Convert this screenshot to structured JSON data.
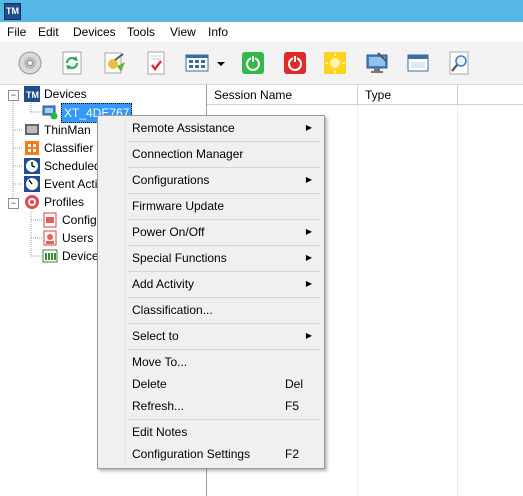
{
  "app": {
    "icon_text": "TM"
  },
  "menu": [
    "File",
    "Edit",
    "Devices",
    "Tools",
    "View",
    "Info"
  ],
  "toolbar": {
    "buttons": [
      "cd-icon",
      "refresh-icon",
      "wizard-icon",
      "checklist-icon",
      "grid-view-icon",
      "dropdown-arrow-icon",
      "power-on-icon",
      "power-off-icon",
      "sun-icon",
      "remote-desktop-icon",
      "window-icon",
      "search-icon"
    ]
  },
  "tree": {
    "devices": "Devices",
    "device_selected": "XT_4DE767",
    "thinman": "ThinMan",
    "classifier": "Classifier",
    "scheduled": "Scheduled",
    "event": "Event Acti",
    "profiles": "Profiles",
    "config": "Config",
    "users": "Users I",
    "device_profile": "Device"
  },
  "table": {
    "columns": [
      "Session Name",
      "Type"
    ]
  },
  "context_menu": [
    {
      "label": "Remote Assistance",
      "submenu": true
    },
    {
      "label": "Connection Manager"
    },
    {
      "label": "Configurations",
      "submenu": true
    },
    {
      "label": "Firmware Update"
    },
    {
      "label": "Power On/Off",
      "submenu": true
    },
    {
      "label": "Special Functions",
      "submenu": true
    },
    {
      "label": "Add Activity",
      "submenu": true
    },
    {
      "label": "Classification..."
    },
    {
      "label": "Select to",
      "submenu": true
    },
    {
      "label": "Move To..."
    },
    {
      "label": "Delete",
      "shortcut": "Del"
    },
    {
      "label": "Refresh...",
      "shortcut": "F5"
    },
    {
      "label": "Edit Notes"
    },
    {
      "label": "Configuration Settings",
      "shortcut": "F2"
    }
  ],
  "colors": {
    "titlebar": "#54b7e6",
    "selection": "#3399ff"
  }
}
